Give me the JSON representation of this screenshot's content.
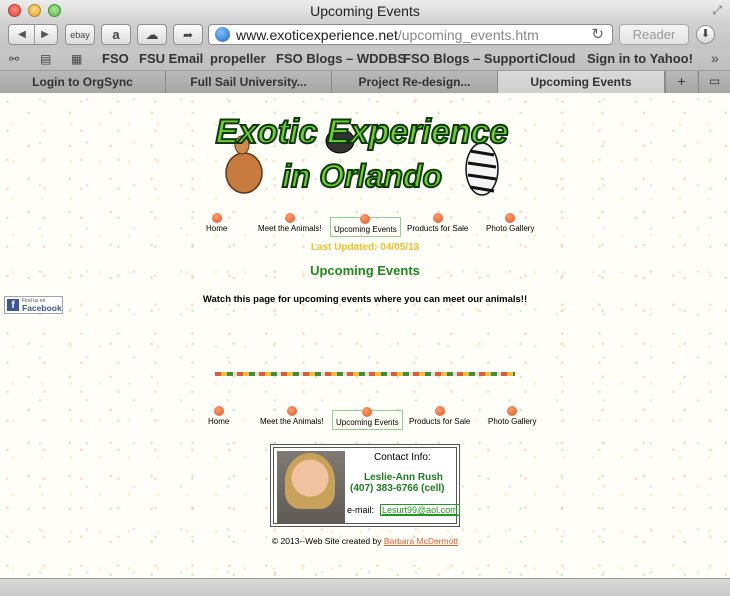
{
  "window": {
    "title": "Upcoming Events"
  },
  "toolbar": {
    "ebay_label": "ebay",
    "amazon_label": "a",
    "url_host": "www.exoticexperience.net",
    "url_path": "/upcoming_events.htm",
    "reader_label": "Reader"
  },
  "bookmarks": {
    "items": [
      "FSO",
      "FSU Email",
      "propeller",
      "FSO Blogs – WDDBS",
      "FSO Blogs – Support",
      "iCloud",
      "Sign in to Yahoo!"
    ]
  },
  "tabs": {
    "items": [
      "Login to OrgSync",
      "Full Sail University...",
      "Project Re-design...",
      "Upcoming Events"
    ],
    "active_index": 3
  },
  "page": {
    "nav": [
      "Home",
      "Meet the Animals!",
      "Upcoming Events",
      "Products for Sale",
      "Photo Gallery"
    ],
    "nav_selected": "Upcoming Events",
    "logo_line1": "Exotic Experience",
    "logo_line2": "in Orlando",
    "last_updated": "Last Updated:  04/05/13",
    "heading": "Upcoming Events",
    "intro": "Watch this page for upcoming events where you can meet our animals!!",
    "facebook": {
      "small": "Find us on",
      "big": "Facebook"
    },
    "contact": {
      "title": "Contact Info:",
      "name": "Leslie-Ann Rush",
      "phone": "(407) 383-6766 (cell)",
      "email_label": "e-mail:",
      "email": "Lesurt99@aol.com"
    },
    "footer": {
      "prefix": "© 2013--Web Site created by",
      "author": "Barbara McDermott"
    }
  }
}
